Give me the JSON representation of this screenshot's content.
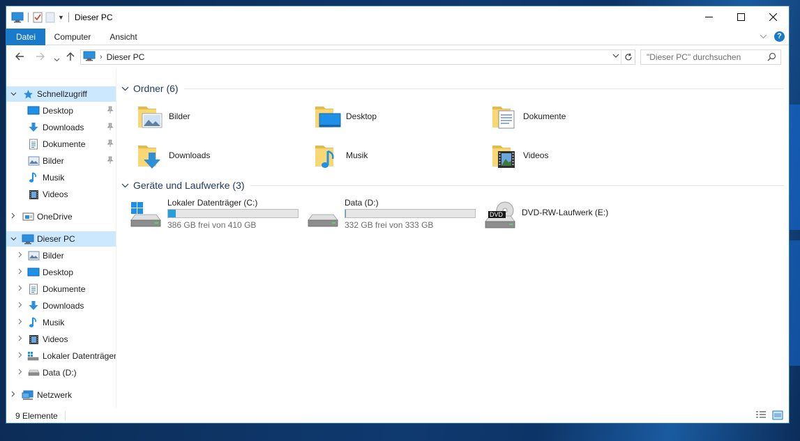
{
  "window": {
    "title": "Dieser PC"
  },
  "ribbon": {
    "tabs": [
      {
        "label": "Datei",
        "active": true
      },
      {
        "label": "Computer",
        "active": false
      },
      {
        "label": "Ansicht",
        "active": false
      }
    ],
    "help_label": "?"
  },
  "address": {
    "breadcrumb": [
      "Dieser PC"
    ]
  },
  "search": {
    "placeholder": "\"Dieser PC\" durchsuchen"
  },
  "nav_pane": {
    "quick_access": {
      "label": "Schnellzugriff",
      "items": [
        {
          "label": "Desktop",
          "icon": "desktop-icon",
          "pinned": true
        },
        {
          "label": "Downloads",
          "icon": "downloads-icon",
          "pinned": true
        },
        {
          "label": "Dokumente",
          "icon": "documents-icon",
          "pinned": true
        },
        {
          "label": "Bilder",
          "icon": "pictures-icon",
          "pinned": true
        },
        {
          "label": "Musik",
          "icon": "music-icon",
          "pinned": false
        },
        {
          "label": "Videos",
          "icon": "videos-icon",
          "pinned": false
        }
      ]
    },
    "onedrive": {
      "label": "OneDrive"
    },
    "this_pc": {
      "label": "Dieser PC",
      "selected": true,
      "items": [
        {
          "label": "Bilder",
          "icon": "pictures-icon"
        },
        {
          "label": "Desktop",
          "icon": "desktop-icon"
        },
        {
          "label": "Dokumente",
          "icon": "documents-icon"
        },
        {
          "label": "Downloads",
          "icon": "downloads-icon"
        },
        {
          "label": "Musik",
          "icon": "music-icon"
        },
        {
          "label": "Videos",
          "icon": "videos-icon"
        },
        {
          "label": "Lokaler Datenträger",
          "icon": "local-disk-icon"
        },
        {
          "label": "Data (D:)",
          "icon": "drive-icon"
        }
      ]
    },
    "network": {
      "label": "Netzwerk"
    }
  },
  "content": {
    "folders_group": {
      "title": "Ordner (6)",
      "items": [
        {
          "label": "Bilder",
          "icon": "pictures-folder-icon"
        },
        {
          "label": "Desktop",
          "icon": "desktop-folder-icon"
        },
        {
          "label": "Dokumente",
          "icon": "documents-folder-icon"
        },
        {
          "label": "Downloads",
          "icon": "downloads-folder-icon"
        },
        {
          "label": "Musik",
          "icon": "music-folder-icon"
        },
        {
          "label": "Videos",
          "icon": "videos-folder-icon"
        }
      ]
    },
    "drives_group": {
      "title": "Geräte und Laufwerke (3)",
      "items": [
        {
          "label": "Lokaler Datenträger (C:)",
          "free_text": "386 GB frei von 410 GB",
          "used_fraction": 0.06,
          "icon": "windows-drive-icon"
        },
        {
          "label": "Data (D:)",
          "free_text": "332 GB frei von 333 GB",
          "used_fraction": 0.003,
          "icon": "drive-icon"
        },
        {
          "label": "DVD-RW-Laufwerk (E:)",
          "icon": "dvd-drive-icon",
          "badge": "DVD"
        }
      ]
    }
  },
  "status": {
    "count": "9 Elemente"
  },
  "colors": {
    "accent": "#1979ca",
    "selection": "#cce8ff",
    "group_title": "#1e395b",
    "bar_fill": "#26a0da"
  }
}
